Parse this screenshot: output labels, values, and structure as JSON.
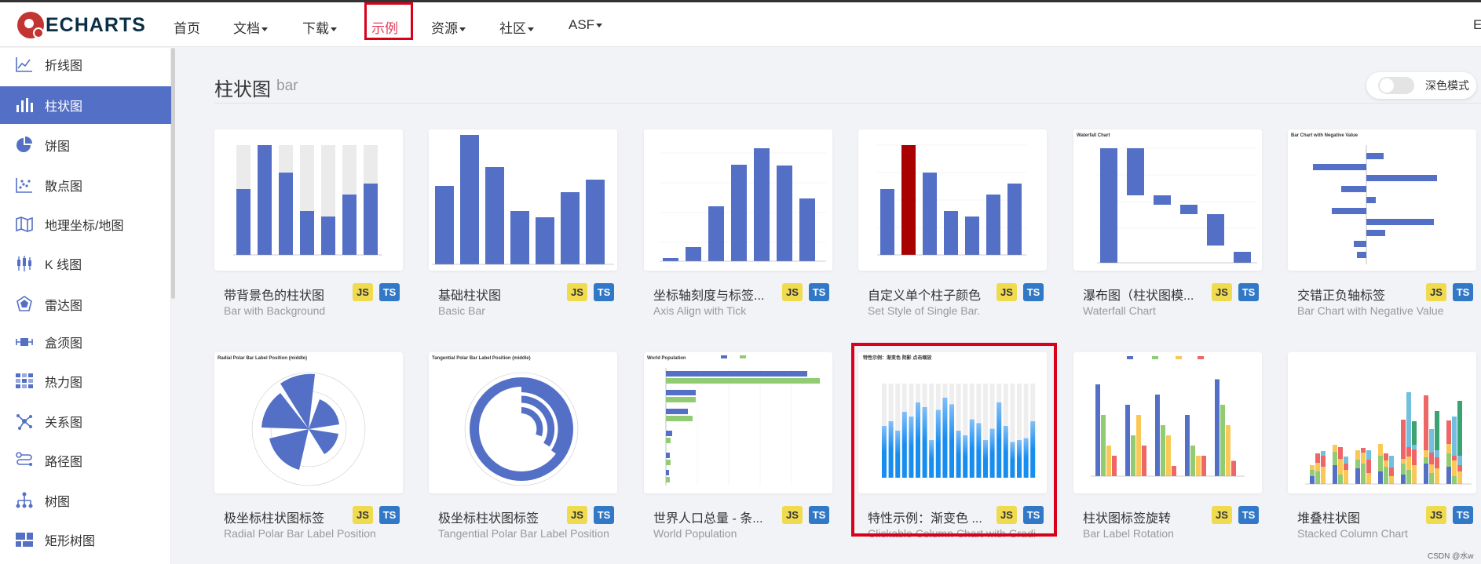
{
  "header": {
    "logo_text": "ECHARTS",
    "nav": [
      {
        "label": "首页",
        "dropdown": false
      },
      {
        "label": "文档",
        "dropdown": true
      },
      {
        "label": "下载",
        "dropdown": true
      },
      {
        "label": "示例",
        "dropdown": false,
        "active": true
      },
      {
        "label": "资源",
        "dropdown": true
      },
      {
        "label": "社区",
        "dropdown": true
      },
      {
        "label": "ASF",
        "dropdown": true
      }
    ],
    "right_label": "E"
  },
  "sidebar": {
    "items": [
      {
        "label": "折线图",
        "icon": "line-chart-icon"
      },
      {
        "label": "柱状图",
        "icon": "bar-chart-icon",
        "active": true
      },
      {
        "label": "饼图",
        "icon": "pie-chart-icon"
      },
      {
        "label": "散点图",
        "icon": "scatter-chart-icon"
      },
      {
        "label": "地理坐标/地图",
        "icon": "map-icon"
      },
      {
        "label": "K 线图",
        "icon": "candlestick-icon"
      },
      {
        "label": "雷达图",
        "icon": "radar-icon"
      },
      {
        "label": "盒须图",
        "icon": "boxplot-icon"
      },
      {
        "label": "热力图",
        "icon": "heatmap-icon"
      },
      {
        "label": "关系图",
        "icon": "graph-icon"
      },
      {
        "label": "路径图",
        "icon": "lines-icon"
      },
      {
        "label": "树图",
        "icon": "tree-icon"
      },
      {
        "label": "矩形树图",
        "icon": "treemap-icon"
      }
    ]
  },
  "main": {
    "title": "柱状图",
    "subtitle": "bar",
    "dark_mode_label": "深色模式",
    "cards": [
      {
        "title": "带背景色的柱状图",
        "subtitle": "Bar with Background",
        "js": "JS",
        "ts": "TS"
      },
      {
        "title": "基础柱状图",
        "subtitle": "Basic Bar",
        "js": "JS",
        "ts": "TS"
      },
      {
        "title": "坐标轴刻度与标签...",
        "subtitle": "Axis Align with Tick",
        "js": "JS",
        "ts": "TS"
      },
      {
        "title": "自定义单个柱子颜色",
        "subtitle": "Set Style of Single Bar.",
        "js": "JS",
        "ts": "TS"
      },
      {
        "title": "瀑布图（柱状图模...",
        "subtitle": "Waterfall Chart",
        "js": "JS",
        "ts": "TS"
      },
      {
        "title": "交错正负轴标签",
        "subtitle": "Bar Chart with Negative Value",
        "js": "JS",
        "ts": "TS"
      },
      {
        "title": "极坐标柱状图标签",
        "subtitle": "Radial Polar Bar Label Position",
        "js": "JS",
        "ts": "TS"
      },
      {
        "title": "极坐标柱状图标签",
        "subtitle": "Tangential Polar Bar Label Position",
        "js": "JS",
        "ts": "TS"
      },
      {
        "title": "世界人口总量 - 条...",
        "subtitle": "World Population",
        "js": "JS",
        "ts": "TS"
      },
      {
        "title": "特性示例：渐变色 ...",
        "subtitle": "Clickable Column Chart with Gradi",
        "js": "JS",
        "ts": "TS"
      },
      {
        "title": "柱状图标签旋转",
        "subtitle": "Bar Label Rotation",
        "js": "JS",
        "ts": "TS"
      },
      {
        "title": "堆叠柱状图",
        "subtitle": "Stacked Column Chart",
        "js": "JS",
        "ts": "TS"
      }
    ],
    "thumb_titles": {
      "waterfall": "Waterfall Chart",
      "negative": "Bar Chart with Negative Value",
      "radial": "Radial Polar Bar Label Position (middle)",
      "tangential": "Tangential Polar Bar Label Position (middle)",
      "population": "World Population",
      "gradient": "特性示例：渐变色 阴影 点击缩放"
    }
  },
  "watermark": "CSDN @水w",
  "colors": {
    "accent": "#5470c6",
    "active_nav": "#e43c59",
    "highlight": "#d9001b",
    "js_badge": "#f0db4f",
    "ts_badge": "#3178c6"
  }
}
